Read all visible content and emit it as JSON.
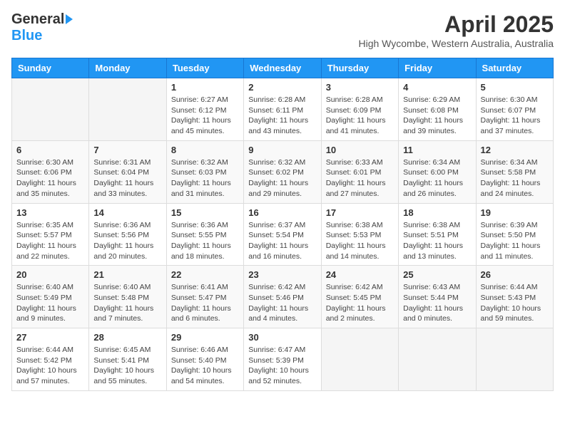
{
  "header": {
    "logo_general": "General",
    "logo_blue": "Blue",
    "month_title": "April 2025",
    "location": "High Wycombe, Western Australia, Australia"
  },
  "days_of_week": [
    "Sunday",
    "Monday",
    "Tuesday",
    "Wednesday",
    "Thursday",
    "Friday",
    "Saturday"
  ],
  "weeks": [
    [
      {
        "day": "",
        "info": ""
      },
      {
        "day": "",
        "info": ""
      },
      {
        "day": "1",
        "info": "Sunrise: 6:27 AM\nSunset: 6:12 PM\nDaylight: 11 hours and 45 minutes."
      },
      {
        "day": "2",
        "info": "Sunrise: 6:28 AM\nSunset: 6:11 PM\nDaylight: 11 hours and 43 minutes."
      },
      {
        "day": "3",
        "info": "Sunrise: 6:28 AM\nSunset: 6:09 PM\nDaylight: 11 hours and 41 minutes."
      },
      {
        "day": "4",
        "info": "Sunrise: 6:29 AM\nSunset: 6:08 PM\nDaylight: 11 hours and 39 minutes."
      },
      {
        "day": "5",
        "info": "Sunrise: 6:30 AM\nSunset: 6:07 PM\nDaylight: 11 hours and 37 minutes."
      }
    ],
    [
      {
        "day": "6",
        "info": "Sunrise: 6:30 AM\nSunset: 6:06 PM\nDaylight: 11 hours and 35 minutes."
      },
      {
        "day": "7",
        "info": "Sunrise: 6:31 AM\nSunset: 6:04 PM\nDaylight: 11 hours and 33 minutes."
      },
      {
        "day": "8",
        "info": "Sunrise: 6:32 AM\nSunset: 6:03 PM\nDaylight: 11 hours and 31 minutes."
      },
      {
        "day": "9",
        "info": "Sunrise: 6:32 AM\nSunset: 6:02 PM\nDaylight: 11 hours and 29 minutes."
      },
      {
        "day": "10",
        "info": "Sunrise: 6:33 AM\nSunset: 6:01 PM\nDaylight: 11 hours and 27 minutes."
      },
      {
        "day": "11",
        "info": "Sunrise: 6:34 AM\nSunset: 6:00 PM\nDaylight: 11 hours and 26 minutes."
      },
      {
        "day": "12",
        "info": "Sunrise: 6:34 AM\nSunset: 5:58 PM\nDaylight: 11 hours and 24 minutes."
      }
    ],
    [
      {
        "day": "13",
        "info": "Sunrise: 6:35 AM\nSunset: 5:57 PM\nDaylight: 11 hours and 22 minutes."
      },
      {
        "day": "14",
        "info": "Sunrise: 6:36 AM\nSunset: 5:56 PM\nDaylight: 11 hours and 20 minutes."
      },
      {
        "day": "15",
        "info": "Sunrise: 6:36 AM\nSunset: 5:55 PM\nDaylight: 11 hours and 18 minutes."
      },
      {
        "day": "16",
        "info": "Sunrise: 6:37 AM\nSunset: 5:54 PM\nDaylight: 11 hours and 16 minutes."
      },
      {
        "day": "17",
        "info": "Sunrise: 6:38 AM\nSunset: 5:53 PM\nDaylight: 11 hours and 14 minutes."
      },
      {
        "day": "18",
        "info": "Sunrise: 6:38 AM\nSunset: 5:51 PM\nDaylight: 11 hours and 13 minutes."
      },
      {
        "day": "19",
        "info": "Sunrise: 6:39 AM\nSunset: 5:50 PM\nDaylight: 11 hours and 11 minutes."
      }
    ],
    [
      {
        "day": "20",
        "info": "Sunrise: 6:40 AM\nSunset: 5:49 PM\nDaylight: 11 hours and 9 minutes."
      },
      {
        "day": "21",
        "info": "Sunrise: 6:40 AM\nSunset: 5:48 PM\nDaylight: 11 hours and 7 minutes."
      },
      {
        "day": "22",
        "info": "Sunrise: 6:41 AM\nSunset: 5:47 PM\nDaylight: 11 hours and 6 minutes."
      },
      {
        "day": "23",
        "info": "Sunrise: 6:42 AM\nSunset: 5:46 PM\nDaylight: 11 hours and 4 minutes."
      },
      {
        "day": "24",
        "info": "Sunrise: 6:42 AM\nSunset: 5:45 PM\nDaylight: 11 hours and 2 minutes."
      },
      {
        "day": "25",
        "info": "Sunrise: 6:43 AM\nSunset: 5:44 PM\nDaylight: 11 hours and 0 minutes."
      },
      {
        "day": "26",
        "info": "Sunrise: 6:44 AM\nSunset: 5:43 PM\nDaylight: 10 hours and 59 minutes."
      }
    ],
    [
      {
        "day": "27",
        "info": "Sunrise: 6:44 AM\nSunset: 5:42 PM\nDaylight: 10 hours and 57 minutes."
      },
      {
        "day": "28",
        "info": "Sunrise: 6:45 AM\nSunset: 5:41 PM\nDaylight: 10 hours and 55 minutes."
      },
      {
        "day": "29",
        "info": "Sunrise: 6:46 AM\nSunset: 5:40 PM\nDaylight: 10 hours and 54 minutes."
      },
      {
        "day": "30",
        "info": "Sunrise: 6:47 AM\nSunset: 5:39 PM\nDaylight: 10 hours and 52 minutes."
      },
      {
        "day": "",
        "info": ""
      },
      {
        "day": "",
        "info": ""
      },
      {
        "day": "",
        "info": ""
      }
    ]
  ]
}
